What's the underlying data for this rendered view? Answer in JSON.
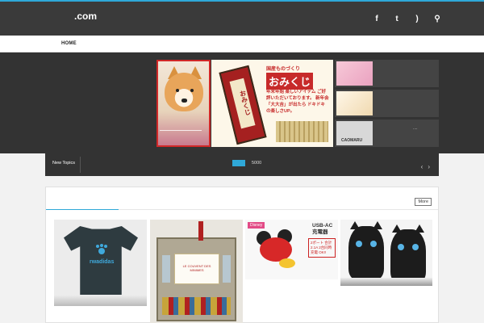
{
  "header": {
    "site_title": ".com",
    "social_icons": [
      "facebook-icon",
      "twitter-icon",
      "rss-icon",
      "search-icon"
    ],
    "social_glyphs": [
      "f",
      "t",
      ")",
      "⚲"
    ]
  },
  "nav": {
    "items": [
      {
        "label": "HOME"
      }
    ]
  },
  "slider": {
    "main_image_header": "国産ものづくり",
    "main_image_title": "おみくじ",
    "main_image_text": "年末年始 楽しいアイテム ご好評いただいております。 新年会「大大吉」が出たら ドキドキの楽しさUP。",
    "main_image_box_label": "おみくじ",
    "thumbnails": [
      {
        "label": ""
      },
      {
        "label": ""
      },
      {
        "label": "CAOMARU",
        "mark": "...."
      }
    ]
  },
  "ticker": {
    "label": "New Topics",
    "text": "5000",
    "prev_glyph": "‹",
    "next_glyph": "›"
  },
  "content": {
    "more_label": "More",
    "cards": [
      {
        "caption": "rwadidas"
      },
      {
        "caption": "LE COUVENT DES MINIMES"
      },
      {
        "badge": "Disney",
        "title": "USB-AC 充電器",
        "note": "2ポート 合計2.1A 2台同時充電 OK!!"
      },
      {
        "caption": ""
      }
    ]
  },
  "colors": {
    "accent": "#2fa8d8",
    "header_bg": "#3a3a3a",
    "slider_bg": "#333333"
  }
}
